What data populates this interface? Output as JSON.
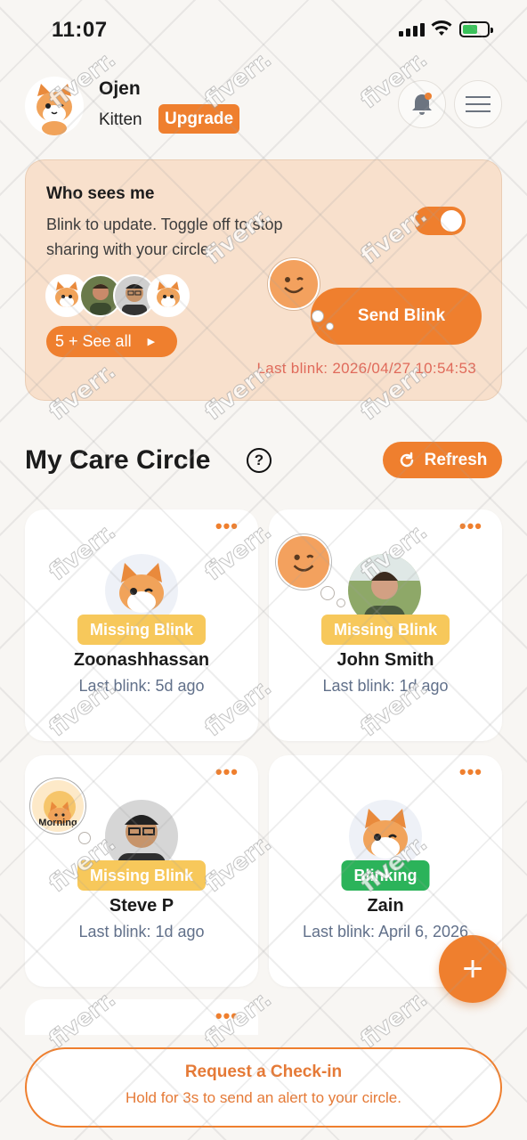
{
  "status_bar": {
    "time": "11:07"
  },
  "header": {
    "name": "Ojen",
    "plan": "Kitten",
    "upgrade_label": "Upgrade"
  },
  "who_sees_me": {
    "title": "Who sees me",
    "description": "Blink to update. Toggle off to stop sharing with your circle.",
    "toggle_on": true,
    "see_all_label": "5 + See all",
    "send_blink_label": "Send Blink",
    "last_blink": "Last blink: 2026/04/27 10:54:53"
  },
  "care_circle": {
    "title": "My Care Circle",
    "help_label": "?",
    "refresh_label": "Refresh",
    "members": [
      {
        "name": "Zoonashhassan",
        "status": "Missing Blink",
        "last_blink": "Last blink: 5d ago"
      },
      {
        "name": "John Smith",
        "status": "Missing Blink",
        "last_blink": "Last blink: 1d ago"
      },
      {
        "name": "Steve P",
        "status": "Missing Blink",
        "last_blink": "Last blink: 1d ago"
      },
      {
        "name": "Zain",
        "status": "Blinking",
        "last_blink": "Last blink: April 6, 2026"
      }
    ],
    "morning_badge": "Morning"
  },
  "fab_label": "+",
  "checkin": {
    "title": "Request a Check-in",
    "subtitle": "Hold for 3s to send an alert to your circle."
  },
  "colors": {
    "accent": "#ef7f2e",
    "card_bg": "#f8e0cc",
    "missing": "#f7c85b",
    "blinking": "#2bb35a"
  }
}
